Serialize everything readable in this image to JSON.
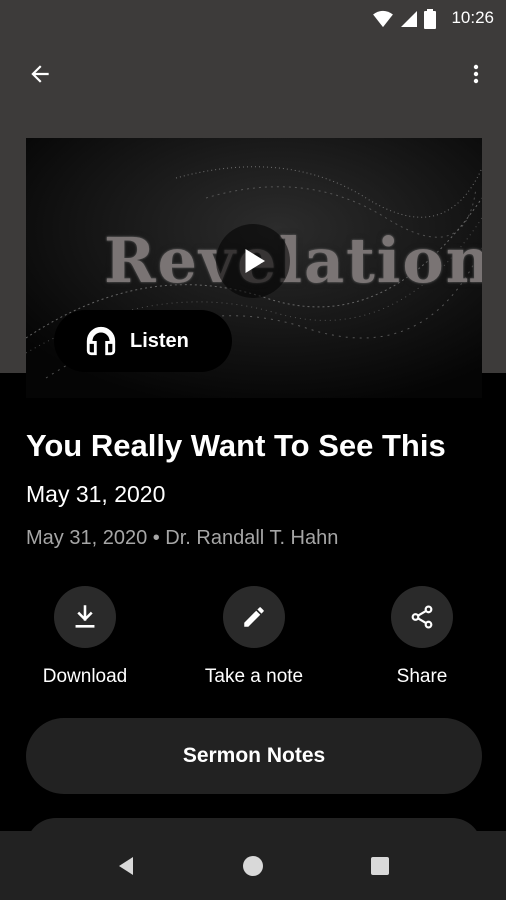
{
  "status_bar": {
    "time": "10:26",
    "icons": [
      "wifi-icon",
      "signal-icon",
      "battery-icon"
    ]
  },
  "app_bar": {
    "back_icon": "arrow-left-icon",
    "menu_icon": "more-vert-icon"
  },
  "hero": {
    "artwork_text": "Revelation",
    "play_icon": "play-icon",
    "listen_label": "Listen",
    "listen_icon": "headphones-icon"
  },
  "sermon": {
    "title": "You Really Want To See This",
    "date": "May 31, 2020",
    "meta": "May 31, 2020 • Dr. Randall T. Hahn"
  },
  "actions": [
    {
      "label": "Download",
      "icon": "download-icon"
    },
    {
      "label": "Take a note",
      "icon": "pencil-icon"
    },
    {
      "label": "Share",
      "icon": "share-icon"
    }
  ],
  "buttons": {
    "sermon_notes": "Sermon Notes"
  },
  "nav_bar": {
    "back": "nav-back-icon",
    "home": "nav-home-icon",
    "recents": "nav-recents-icon"
  },
  "colors": {
    "header_bg": "#3d3b3a",
    "page_bg": "#000000",
    "button_bg": "#222222",
    "secondary_text": "#a6a6a6"
  }
}
